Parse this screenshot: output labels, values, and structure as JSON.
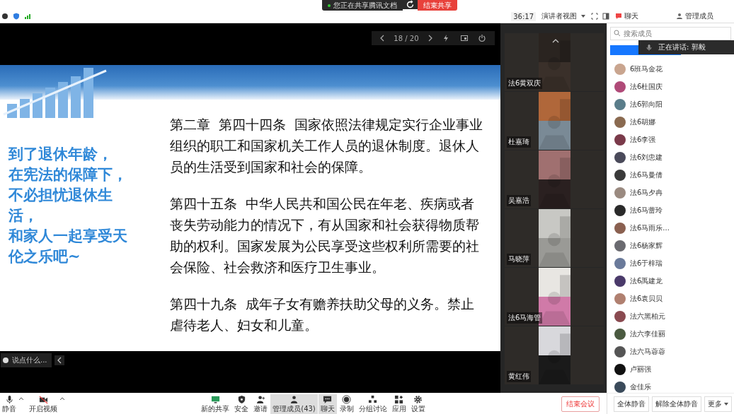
{
  "top_bar": {
    "share_notice": "您正在共享腾讯文档",
    "stop_share_button": "结束共享",
    "timer": "36:17",
    "view_button": "演讲者视图",
    "panels": [
      {
        "label": "聊天",
        "kind": "chat"
      },
      {
        "label": "管理成员",
        "kind": "members"
      }
    ]
  },
  "presentation": {
    "page": "18 / 20",
    "caption_lines": [
      "到了退休年龄，",
      "在宪法的保障下，",
      "不必担忧退休生",
      "活，",
      "和家人一起享受天",
      "伦之乐吧~"
    ],
    "articles": [
      "第二章  第四十四条  国家依照法律规定实行企业事业组织的职工和国家机关工作人员的退休制度。退休人员的生活受到国家和社会的保障。",
      "第四十五条  中华人民共和国公民在年老、疾病或者丧失劳动能力的情况下，有从国家和社会获得物质帮助的权利。国家发展为公民享受这些权利所需要的社会保险、社会救济和医疗卫生事业。",
      "第四十九条  成年子女有赡养扶助父母的义务。禁止虐待老人、妇女和儿童。"
    ],
    "chat_placeholder": "说点什么..."
  },
  "videos": [
    {
      "name": "法6黄双庆"
    },
    {
      "name": "杜嘉琦"
    },
    {
      "name": "吴嘉浩"
    },
    {
      "name": "马晓萍"
    },
    {
      "name": "法6马海管"
    },
    {
      "name": "黄红伟"
    }
  ],
  "members": {
    "search_placeholder": "搜索成员",
    "speaking": "正在讲话: 郭毅",
    "items": [
      {
        "name": "6班马金花"
      },
      {
        "name": "法6杜国庆"
      },
      {
        "name": "法6郭向阳"
      },
      {
        "name": "法6胡娜"
      },
      {
        "name": "法6李强"
      },
      {
        "name": "法6刘忠建"
      },
      {
        "name": "法6马曼倩"
      },
      {
        "name": "法6马夕冉"
      },
      {
        "name": "法6马蕾玲"
      },
      {
        "name": "法6马雨乐..."
      },
      {
        "name": "法6杨家辉"
      },
      {
        "name": "法6于梓瑞"
      },
      {
        "name": "法6禹建龙"
      },
      {
        "name": "法6袁贝贝"
      },
      {
        "name": "法六黑柏元"
      },
      {
        "name": "法六李佳丽"
      },
      {
        "name": "法六马蓉蓉"
      },
      {
        "name": "卢丽强"
      },
      {
        "name": "金佳乐"
      }
    ],
    "buttons": [
      "全体静音",
      "解除全体静音",
      "更多"
    ]
  },
  "toolbar": {
    "left": [
      {
        "label": "静音",
        "kind": "mic"
      },
      {
        "label": "开启视频",
        "kind": "camera"
      }
    ],
    "center": [
      {
        "label": "新的共享",
        "kind": "share",
        "selected": false
      },
      {
        "label": "安全",
        "kind": "shield",
        "selected": false
      },
      {
        "label": "邀请",
        "kind": "invite",
        "selected": false
      },
      {
        "label": "管理成员(43)",
        "kind": "members",
        "selected": true
      },
      {
        "label": "聊天",
        "kind": "chat",
        "selected": true
      },
      {
        "label": "录制",
        "kind": "record",
        "selected": false
      },
      {
        "label": "分组讨论",
        "kind": "groups",
        "selected": false
      },
      {
        "label": "应用",
        "kind": "apps",
        "selected": false
      },
      {
        "label": "设置",
        "kind": "gear",
        "selected": false
      }
    ],
    "end_button": "结束会议"
  }
}
